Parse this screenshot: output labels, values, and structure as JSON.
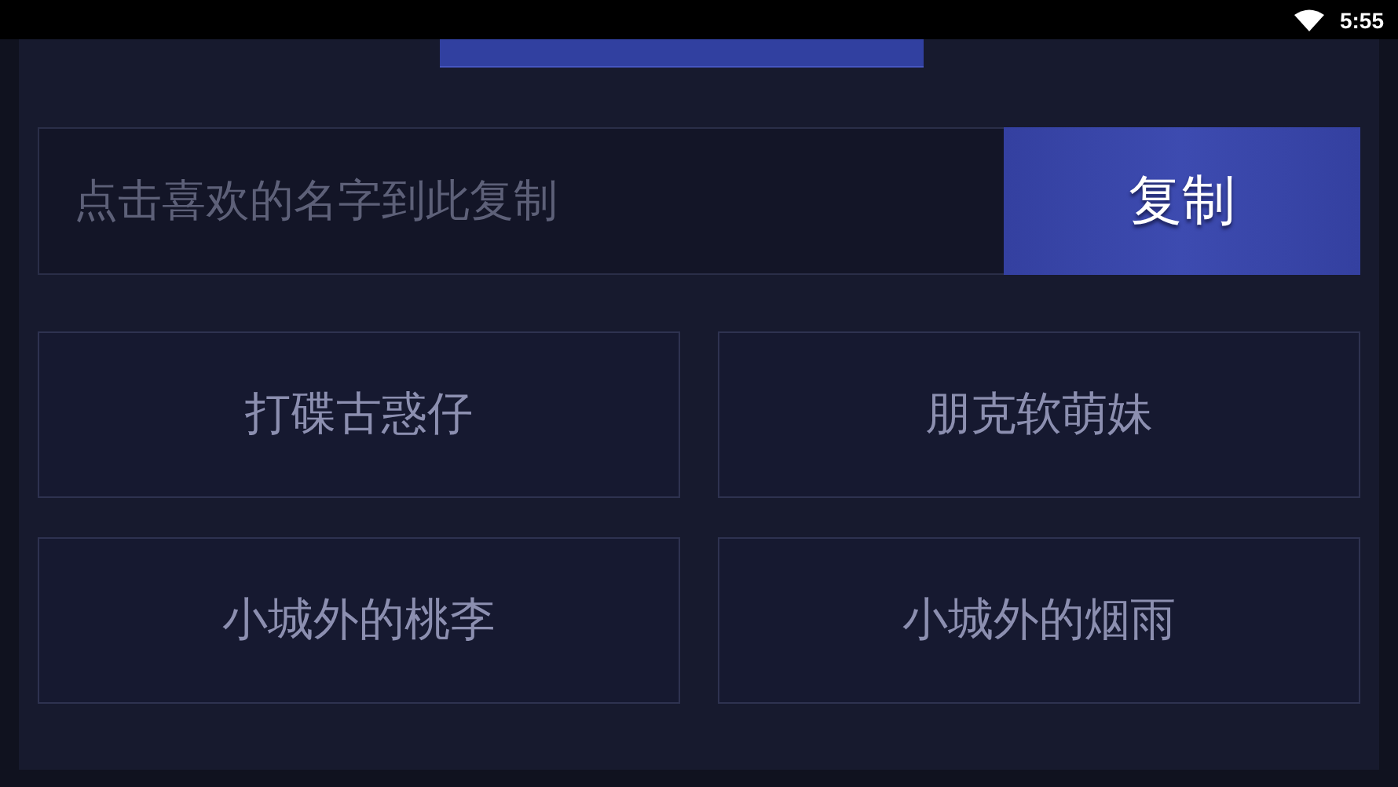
{
  "status_bar": {
    "time": "5:55"
  },
  "copy_field": {
    "placeholder": "点击喜欢的名字到此复制"
  },
  "copy_button": {
    "label": "复制"
  },
  "names": [
    {
      "label": "打碟古惑仔"
    },
    {
      "label": "朋克软萌妹"
    },
    {
      "label": "小城外的桃李"
    },
    {
      "label": "小城外的烟雨"
    }
  ]
}
